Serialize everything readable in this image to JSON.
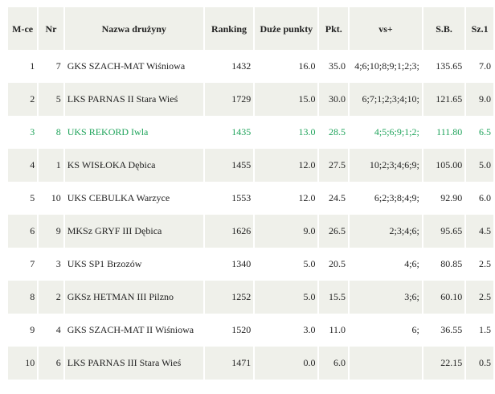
{
  "headers": {
    "pos": "M-ce",
    "nr": "Nr",
    "name": "Nazwa drużyny",
    "rank": "Ranking",
    "duze": "Duże punkty",
    "pkt": "Pkt.",
    "vs": "vs+",
    "sb": "S.B.",
    "sz": "Sz.1"
  },
  "highlight_color": "#1ea35a",
  "rows": [
    {
      "pos": "1",
      "nr": "7",
      "name": "GKS SZACH-MAT Wiśniowa",
      "rank": "1432",
      "duze": "16.0",
      "pkt": "35.0",
      "vs": "4;6;10;8;9;1;2;3;",
      "sb": "135.65",
      "sz": "7.0"
    },
    {
      "pos": "2",
      "nr": "5",
      "name": "LKS PARNAS II Stara Wieś",
      "rank": "1729",
      "duze": "15.0",
      "pkt": "30.0",
      "vs": "6;7;1;2;3;4;10;",
      "sb": "121.65",
      "sz": "9.0"
    },
    {
      "pos": "3",
      "nr": "8",
      "name": "UKS REKORD Iwla",
      "rank": "1435",
      "duze": "13.0",
      "pkt": "28.5",
      "vs": "4;5;6;9;1;2;",
      "sb": "111.80",
      "sz": "6.5",
      "highlight": true
    },
    {
      "pos": "4",
      "nr": "1",
      "name": "KS WISŁOKA Dębica",
      "rank": "1455",
      "duze": "12.0",
      "pkt": "27.5",
      "vs": "10;2;3;4;6;9;",
      "sb": "105.00",
      "sz": "5.0"
    },
    {
      "pos": "5",
      "nr": "10",
      "name": "UKS CEBULKA Warzyce",
      "rank": "1553",
      "duze": "12.0",
      "pkt": "24.5",
      "vs": "6;2;3;8;4;9;",
      "sb": "92.90",
      "sz": "6.0"
    },
    {
      "pos": "6",
      "nr": "9",
      "name": "MKSz GRYF III Dębica",
      "rank": "1626",
      "duze": "9.0",
      "pkt": "26.5",
      "vs": "2;3;4;6;",
      "sb": "95.65",
      "sz": "4.5"
    },
    {
      "pos": "7",
      "nr": "3",
      "name": "UKS SP1 Brzozów",
      "rank": "1340",
      "duze": "5.0",
      "pkt": "20.5",
      "vs": "4;6;",
      "sb": "80.85",
      "sz": "2.5"
    },
    {
      "pos": "8",
      "nr": "2",
      "name": "GKSz HETMAN III Pilzno",
      "rank": "1252",
      "duze": "5.0",
      "pkt": "15.5",
      "vs": "3;6;",
      "sb": "60.10",
      "sz": "2.5"
    },
    {
      "pos": "9",
      "nr": "4",
      "name": "GKS SZACH-MAT II Wiśniowa",
      "rank": "1520",
      "duze": "3.0",
      "pkt": "11.0",
      "vs": "6;",
      "sb": "36.55",
      "sz": "1.5",
      "wrap": true
    },
    {
      "pos": "10",
      "nr": "6",
      "name": "LKS PARNAS III Stara Wieś",
      "rank": "1471",
      "duze": "0.0",
      "pkt": "6.0",
      "vs": "",
      "sb": "22.15",
      "sz": "0.5"
    }
  ]
}
